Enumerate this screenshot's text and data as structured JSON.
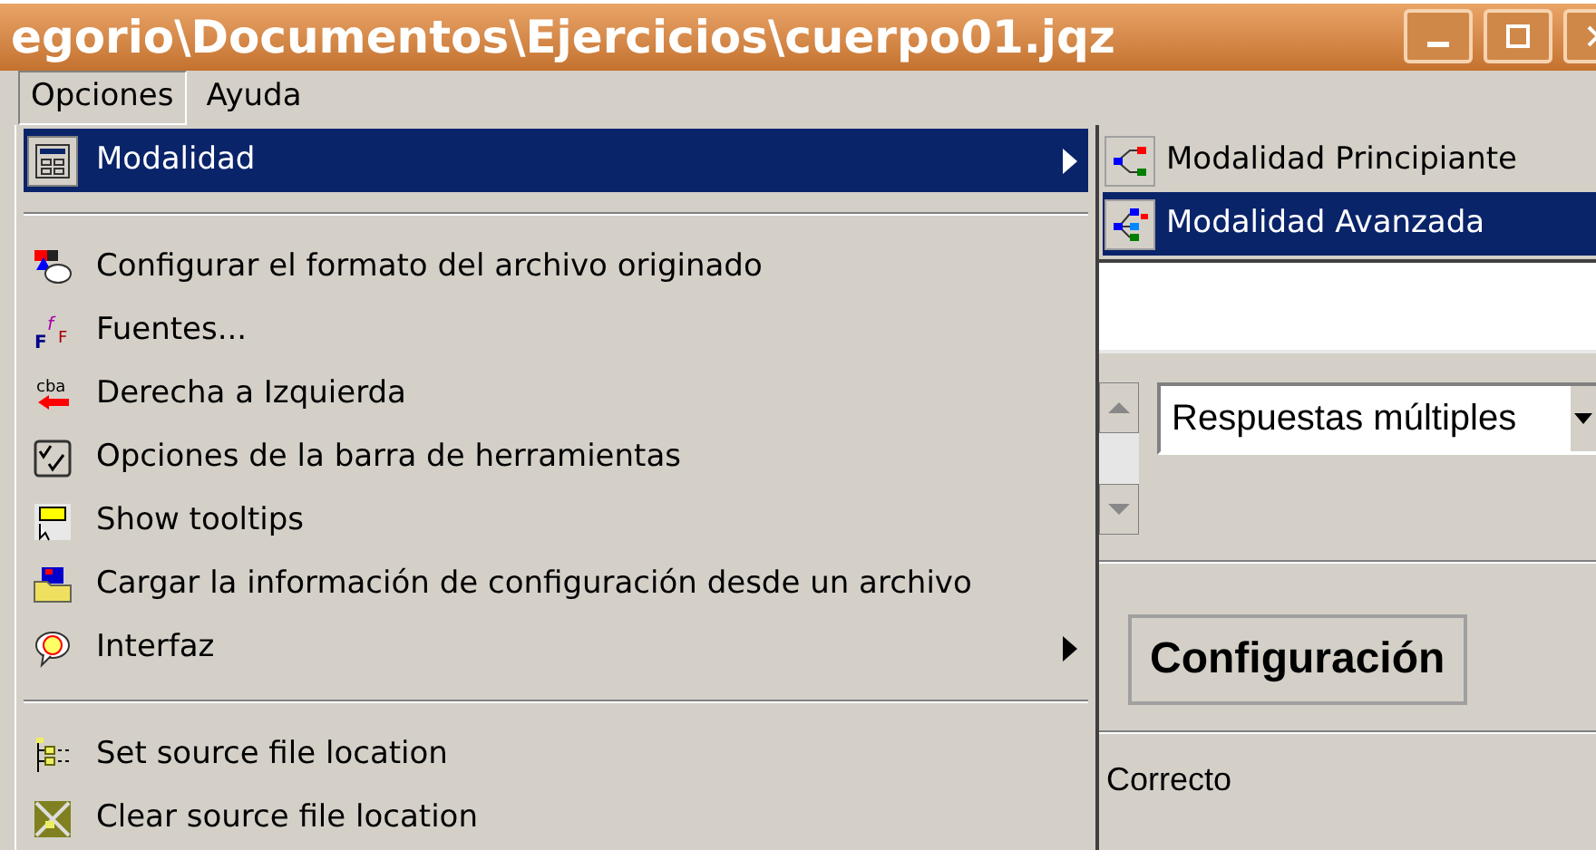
{
  "window": {
    "title": "egorio\\Documentos\\Ejercicios\\cuerpo01.jqz"
  },
  "menubar": [
    {
      "label": "Opciones",
      "selected": true
    },
    {
      "label": "Ayuda",
      "selected": false
    }
  ],
  "menu": [
    {
      "kind": "item",
      "label": "Modalidad",
      "selected": true,
      "has_submenu": true
    },
    {
      "kind": "separator"
    },
    {
      "kind": "item",
      "label": "Configurar el formato del archivo originado",
      "selected": false,
      "has_submenu": false
    },
    {
      "kind": "item",
      "label": "Fuentes...",
      "selected": false,
      "has_submenu": false,
      "icon_text": [
        "F",
        "f",
        "F"
      ]
    },
    {
      "kind": "item",
      "label": "Derecha a Izquierda",
      "selected": false,
      "has_submenu": false,
      "icon_text": [
        "cba"
      ]
    },
    {
      "kind": "item",
      "label": "Opciones de la barra de herramientas",
      "selected": false,
      "has_submenu": false
    },
    {
      "kind": "item",
      "label": "Show tooltips",
      "selected": false,
      "has_submenu": false
    },
    {
      "kind": "item",
      "label": "Cargar la información de configuración desde un archivo",
      "selected": false,
      "has_submenu": false
    },
    {
      "kind": "item",
      "label": "Interfaz",
      "selected": false,
      "has_submenu": true
    },
    {
      "kind": "separator"
    },
    {
      "kind": "item",
      "label": "Set source file location",
      "selected": false,
      "has_submenu": false
    },
    {
      "kind": "item",
      "label": "Clear source file location",
      "selected": false,
      "has_submenu": false
    }
  ],
  "submenu": [
    {
      "label": "Modalidad Principiante",
      "selected": false
    },
    {
      "label": "Modalidad Avanzada",
      "selected": true
    }
  ],
  "question_type": {
    "value": "Respuestas múltiples"
  },
  "config_button": "Configuración",
  "status": "Correcto"
}
